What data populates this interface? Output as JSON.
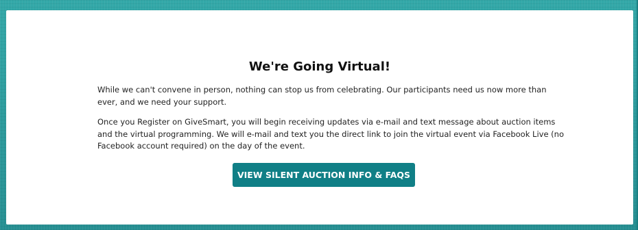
{
  "announcement": {
    "title": "We're Going Virtual!",
    "paragraph_1": "While we can't convene in person, nothing can stop us from celebrating. Our participants need us now more than ever, and we need your support.",
    "paragraph_2": "Once you Register on GiveSmart, you will begin receiving updates via e-mail and text message about auction items and the virtual programming. We will e-mail and text you the direct link to join the virtual event via Facebook Live (no Facebook account required) on the day of the event.",
    "cta_label": "VIEW SILENT AUCTION INFO & FAQS"
  },
  "colors": {
    "frame": "#2a9a9c",
    "button": "#107f86",
    "card": "#ffffff"
  }
}
